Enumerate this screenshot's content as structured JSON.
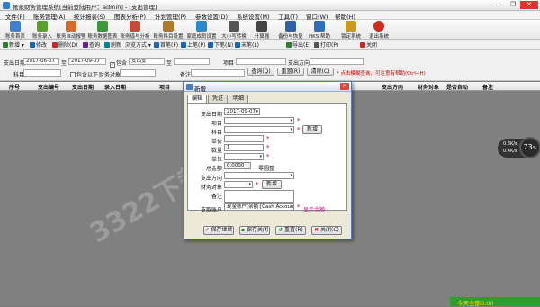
{
  "window": {
    "title": "帐家财务管理系统[当前登陆用户：admin] - [支出管理]",
    "controls": [
      "—",
      "❐",
      "✕"
    ]
  },
  "menu": [
    "文件(F)",
    "账务管理(A)",
    "统计报表(S)",
    "图表分析(P)",
    "计划管理(P)",
    "参数设置(D)",
    "系统设置(M)",
    "工具(T)",
    "窗口(W)",
    "帮助(H)"
  ],
  "toolbar": [
    {
      "label": "账务首页",
      "icon": "home-icon",
      "color": "#3f7fd0"
    },
    {
      "label": "账务录入",
      "icon": "entry-icon",
      "color": "#5aa02c"
    },
    {
      "label": "账务自动报警",
      "icon": "alarm-icon",
      "color": "#d96b2a"
    },
    {
      "label": "账务数据图表",
      "icon": "chart-icon",
      "color": "#3a9a3a"
    },
    {
      "label": "账务借与分析",
      "icon": "analysis-icon",
      "color": "#c44a3a"
    },
    {
      "label": "账务科目设置",
      "icon": "subject-icon",
      "color": "#b07a2a"
    },
    {
      "label": "家庭成员设置",
      "icon": "family-icon",
      "color": "#2a8ad0"
    },
    {
      "label": "大小写转换",
      "icon": "convert-icon",
      "color": "#555555"
    },
    {
      "label": "计算器",
      "icon": "calculator-icon",
      "color": "#444444"
    },
    {
      "label": "备份与恢复",
      "icon": "backup-icon",
      "color": "#2e5fa8"
    },
    {
      "label": "HKS 帮助",
      "icon": "help-icon",
      "color": "#2d6fbd"
    },
    {
      "label": "锁定系统",
      "icon": "lock-icon",
      "color": "#c99a1e"
    },
    {
      "label": "退出系统",
      "icon": "exit-icon",
      "color": "#d02b1e"
    }
  ],
  "toolbar2": [
    {
      "label": "新增 ▾",
      "color": "#2e7d32"
    },
    {
      "label": "修改",
      "color": "#1565c0"
    },
    {
      "label": "删除(D)",
      "color": "#c62828"
    },
    {
      "label": "查询",
      "color": "#6a1b9a"
    },
    {
      "label": "刷新",
      "color": "#00838f"
    },
    {
      "label": "浏览方式 ▾",
      "color": "#555555"
    },
    {
      "label": "首笔(F)",
      "color": "#1565c0"
    },
    {
      "label": "上笔(P)",
      "color": "#1565c0"
    },
    {
      "label": "下笔(N)",
      "color": "#1565c0"
    },
    {
      "label": "末笔(L)",
      "color": "#1565c0"
    },
    {
      "label": "导出(E)",
      "color": "#2e7d32"
    },
    {
      "label": "打印(P)",
      "color": "#555555"
    },
    {
      "label": "关闭",
      "color": "#c62828"
    }
  ],
  "filter": {
    "date_label": "支出日期",
    "date_from": "2017-06-07",
    "to_label": "至",
    "date_to": "2017-09-07",
    "include_label": "包含",
    "time_label": "支出支",
    "to2_label": "至",
    "project_label": "项目",
    "direction_label": "支出方向",
    "subject_label": "科目",
    "include_sub_label": "包含以下",
    "account_label": "财务对象",
    "note_label": "备注",
    "query_btn": "查询(Q)",
    "reset_btn": "重置(R)",
    "clear_btn": "清除(C)",
    "hint": "* 点击模糊查询，可注意有帮助(Ctrl+H)"
  },
  "grid": {
    "columns": [
      "序号",
      "支出编号",
      "支出日期",
      "录入日期",
      "项目",
      "支出方向",
      "财务对象",
      "是否自动",
      "备注"
    ]
  },
  "dialog": {
    "title": "新增",
    "tabs": [
      "编辑",
      "凭证",
      "明细"
    ],
    "date_label": "支出日期",
    "date_value": "2017-09-07",
    "project_label": "项目",
    "subject_label": "科目",
    "new_btn": "新增",
    "unit_price_label": "单价",
    "qty_label": "数量",
    "qty_value": "1",
    "unit_label": "单位",
    "amount_label": "总金额",
    "amount_value": "0.0000",
    "amount_extra": "零圆整",
    "direction_label": "支出方向",
    "object_label": "财务对象",
    "new_btn2": "新增",
    "note_label": "备注",
    "account_label": "支取账户",
    "account_value": "现金账户(余额:[Cash Account,800000000",
    "show_balance_link": "显示余额",
    "buttons": [
      "保存继续",
      "保存关闭",
      "重置(R)",
      "关闭(C)"
    ]
  },
  "speedo": {
    "value": "73",
    "unit": "%",
    "up": "0.3K/s",
    "down": "0.4K/s"
  },
  "statusbar": {
    "text": "今天全部0.00"
  },
  "watermark": "3322下载站"
}
